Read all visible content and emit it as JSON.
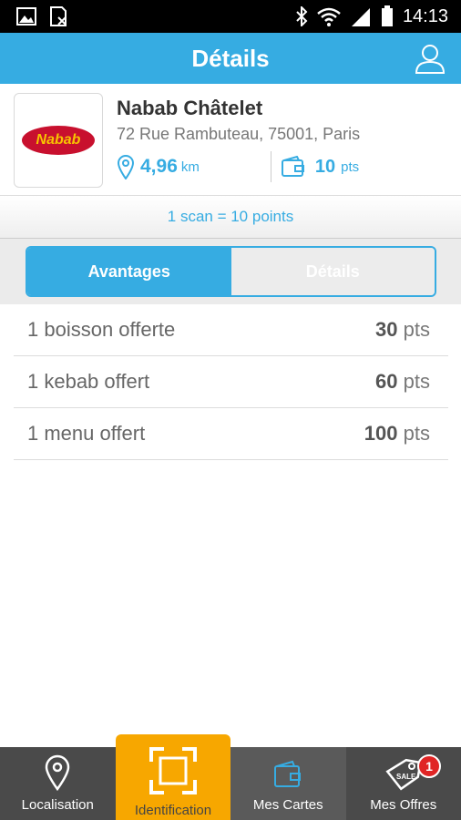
{
  "status_bar": {
    "time": "14:13"
  },
  "header": {
    "title": "Détails",
    "user_icon": "user-icon"
  },
  "store": {
    "name": "Nabab Châtelet",
    "address": "72 Rue Rambuteau, 75001, Paris",
    "logo_text": "Nabab",
    "distance": "4,96",
    "distance_unit": "km",
    "points": "10",
    "points_unit": "pts"
  },
  "scan_info": "1 scan = 10 points",
  "tabs": [
    {
      "label": "Avantages",
      "active": true
    },
    {
      "label": "Détails",
      "active": false
    }
  ],
  "rewards": [
    {
      "label": "1 boisson offerte",
      "points": "30",
      "unit": "pts"
    },
    {
      "label": "1 kebab offert",
      "points": "60",
      "unit": "pts"
    },
    {
      "label": "1 menu offert",
      "points": "100",
      "unit": "pts"
    }
  ],
  "bottom_nav": [
    {
      "label": "Localisation",
      "icon": "location-pin-icon"
    },
    {
      "label": "Identification",
      "icon": "scan-frame-icon",
      "active": true
    },
    {
      "label": "Mes Cartes",
      "icon": "wallet-icon"
    },
    {
      "label": "Mes Offres",
      "icon": "tag-icon",
      "badge": "1"
    }
  ],
  "colors": {
    "accent": "#36ace2",
    "nav_bg": "#4a4a4a",
    "highlight": "#f7a700",
    "badge": "#e02424"
  }
}
